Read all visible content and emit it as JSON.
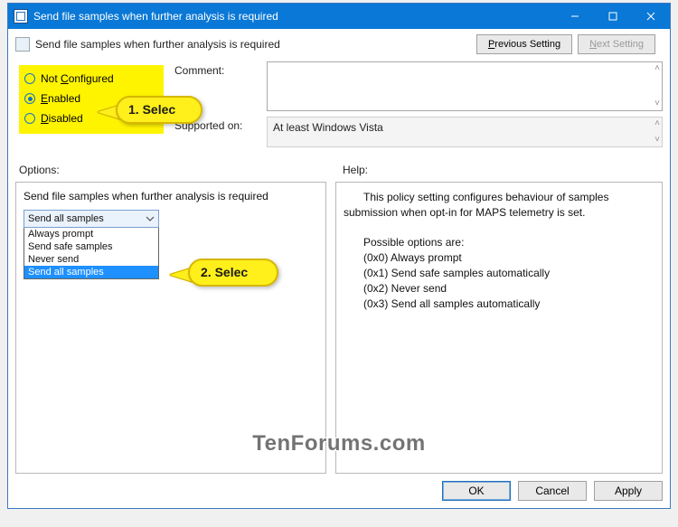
{
  "window": {
    "title": "Send file samples when further analysis is required"
  },
  "header": {
    "title": "Send file samples when further analysis is required"
  },
  "nav": {
    "prev": "Previous Setting",
    "next": "Next Setting"
  },
  "config": {
    "not_configured": "Not Configured",
    "enabled": "Enabled",
    "disabled": "Disabled",
    "selected": "enabled"
  },
  "fields": {
    "comment_label": "Comment:",
    "comment_value": "",
    "supported_label": "Supported on:",
    "supported_value": "At least Windows Vista"
  },
  "labels": {
    "options": "Options:",
    "help": "Help:"
  },
  "options": {
    "caption": "Send file samples when further analysis is required",
    "selected": "Send all samples",
    "items": [
      "Always prompt",
      "Send safe samples",
      "Never send",
      "Send all samples"
    ],
    "highlighted": "Send all samples"
  },
  "help": {
    "lead": "This policy setting configures behaviour of samples submission when opt-in for MAPS telemetry is set.",
    "possible_label": "Possible options are:",
    "opts": [
      "(0x0) Always prompt",
      "(0x1) Send safe samples automatically",
      "(0x2) Never send",
      "(0x3) Send all samples automatically"
    ]
  },
  "buttons": {
    "ok": "OK",
    "cancel": "Cancel",
    "apply": "Apply"
  },
  "annotations": {
    "step1": "1. Selec",
    "step2": "2. Selec"
  },
  "watermark": "TenForums.com"
}
